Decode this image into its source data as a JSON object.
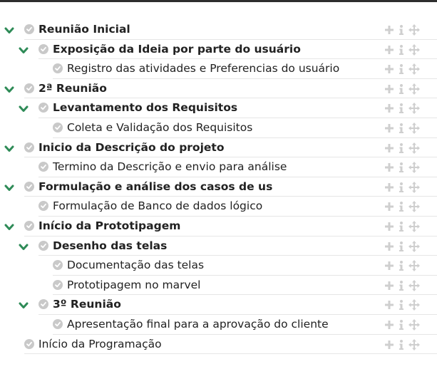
{
  "tasks": [
    {
      "label": "Reunião Inicial",
      "level": 0,
      "bold": true,
      "toggle": true
    },
    {
      "label": "Exposição da Ideia por parte do usuário",
      "level": 1,
      "bold": true,
      "toggle": true
    },
    {
      "label": "Registro das atividades e Preferencias do usuário",
      "level": 2,
      "bold": false,
      "toggle": false
    },
    {
      "label": "2ª Reunião",
      "level": 0,
      "bold": true,
      "toggle": true
    },
    {
      "label": "Levantamento dos Requisitos",
      "level": 1,
      "bold": true,
      "toggle": true
    },
    {
      "label": "Coleta e Validação dos Requisitos",
      "level": 2,
      "bold": false,
      "toggle": false
    },
    {
      "label": "Inicio da Descrição do projeto",
      "level": 0,
      "bold": true,
      "toggle": true
    },
    {
      "label": "Termino da Descrição e envio para análise",
      "level": 1,
      "bold": false,
      "toggle": false
    },
    {
      "label": "Formulação e análise dos casos de us",
      "level": 0,
      "bold": true,
      "toggle": true
    },
    {
      "label": "Formulação de Banco de dados lógico",
      "level": 1,
      "bold": false,
      "toggle": false
    },
    {
      "label": "Início da Prototipagem",
      "level": 0,
      "bold": true,
      "toggle": true
    },
    {
      "label": "Desenho das telas",
      "level": 1,
      "bold": true,
      "toggle": true
    },
    {
      "label": "Documentação das telas",
      "level": 2,
      "bold": false,
      "toggle": false
    },
    {
      "label": "Prototipagem no marvel",
      "level": 2,
      "bold": false,
      "toggle": false
    },
    {
      "label": "3º Reunião",
      "level": 1,
      "bold": true,
      "toggle": true
    },
    {
      "label": "Apresentação final para a aprovação do cliente",
      "level": 2,
      "bold": false,
      "toggle": false
    },
    {
      "label": "Início da Programação",
      "level": 0,
      "bold": false,
      "toggle": false
    }
  ],
  "icons": {
    "toggle": "chevron-down-icon",
    "check": "check-circle-icon",
    "add": "plus-icon",
    "info": "info-icon",
    "move": "move-icon"
  },
  "colors": {
    "toggle": "#2e8b57",
    "check_bg": "#c9c9c9",
    "action": "#cfcfcf",
    "divider": "#e6e6e6"
  }
}
